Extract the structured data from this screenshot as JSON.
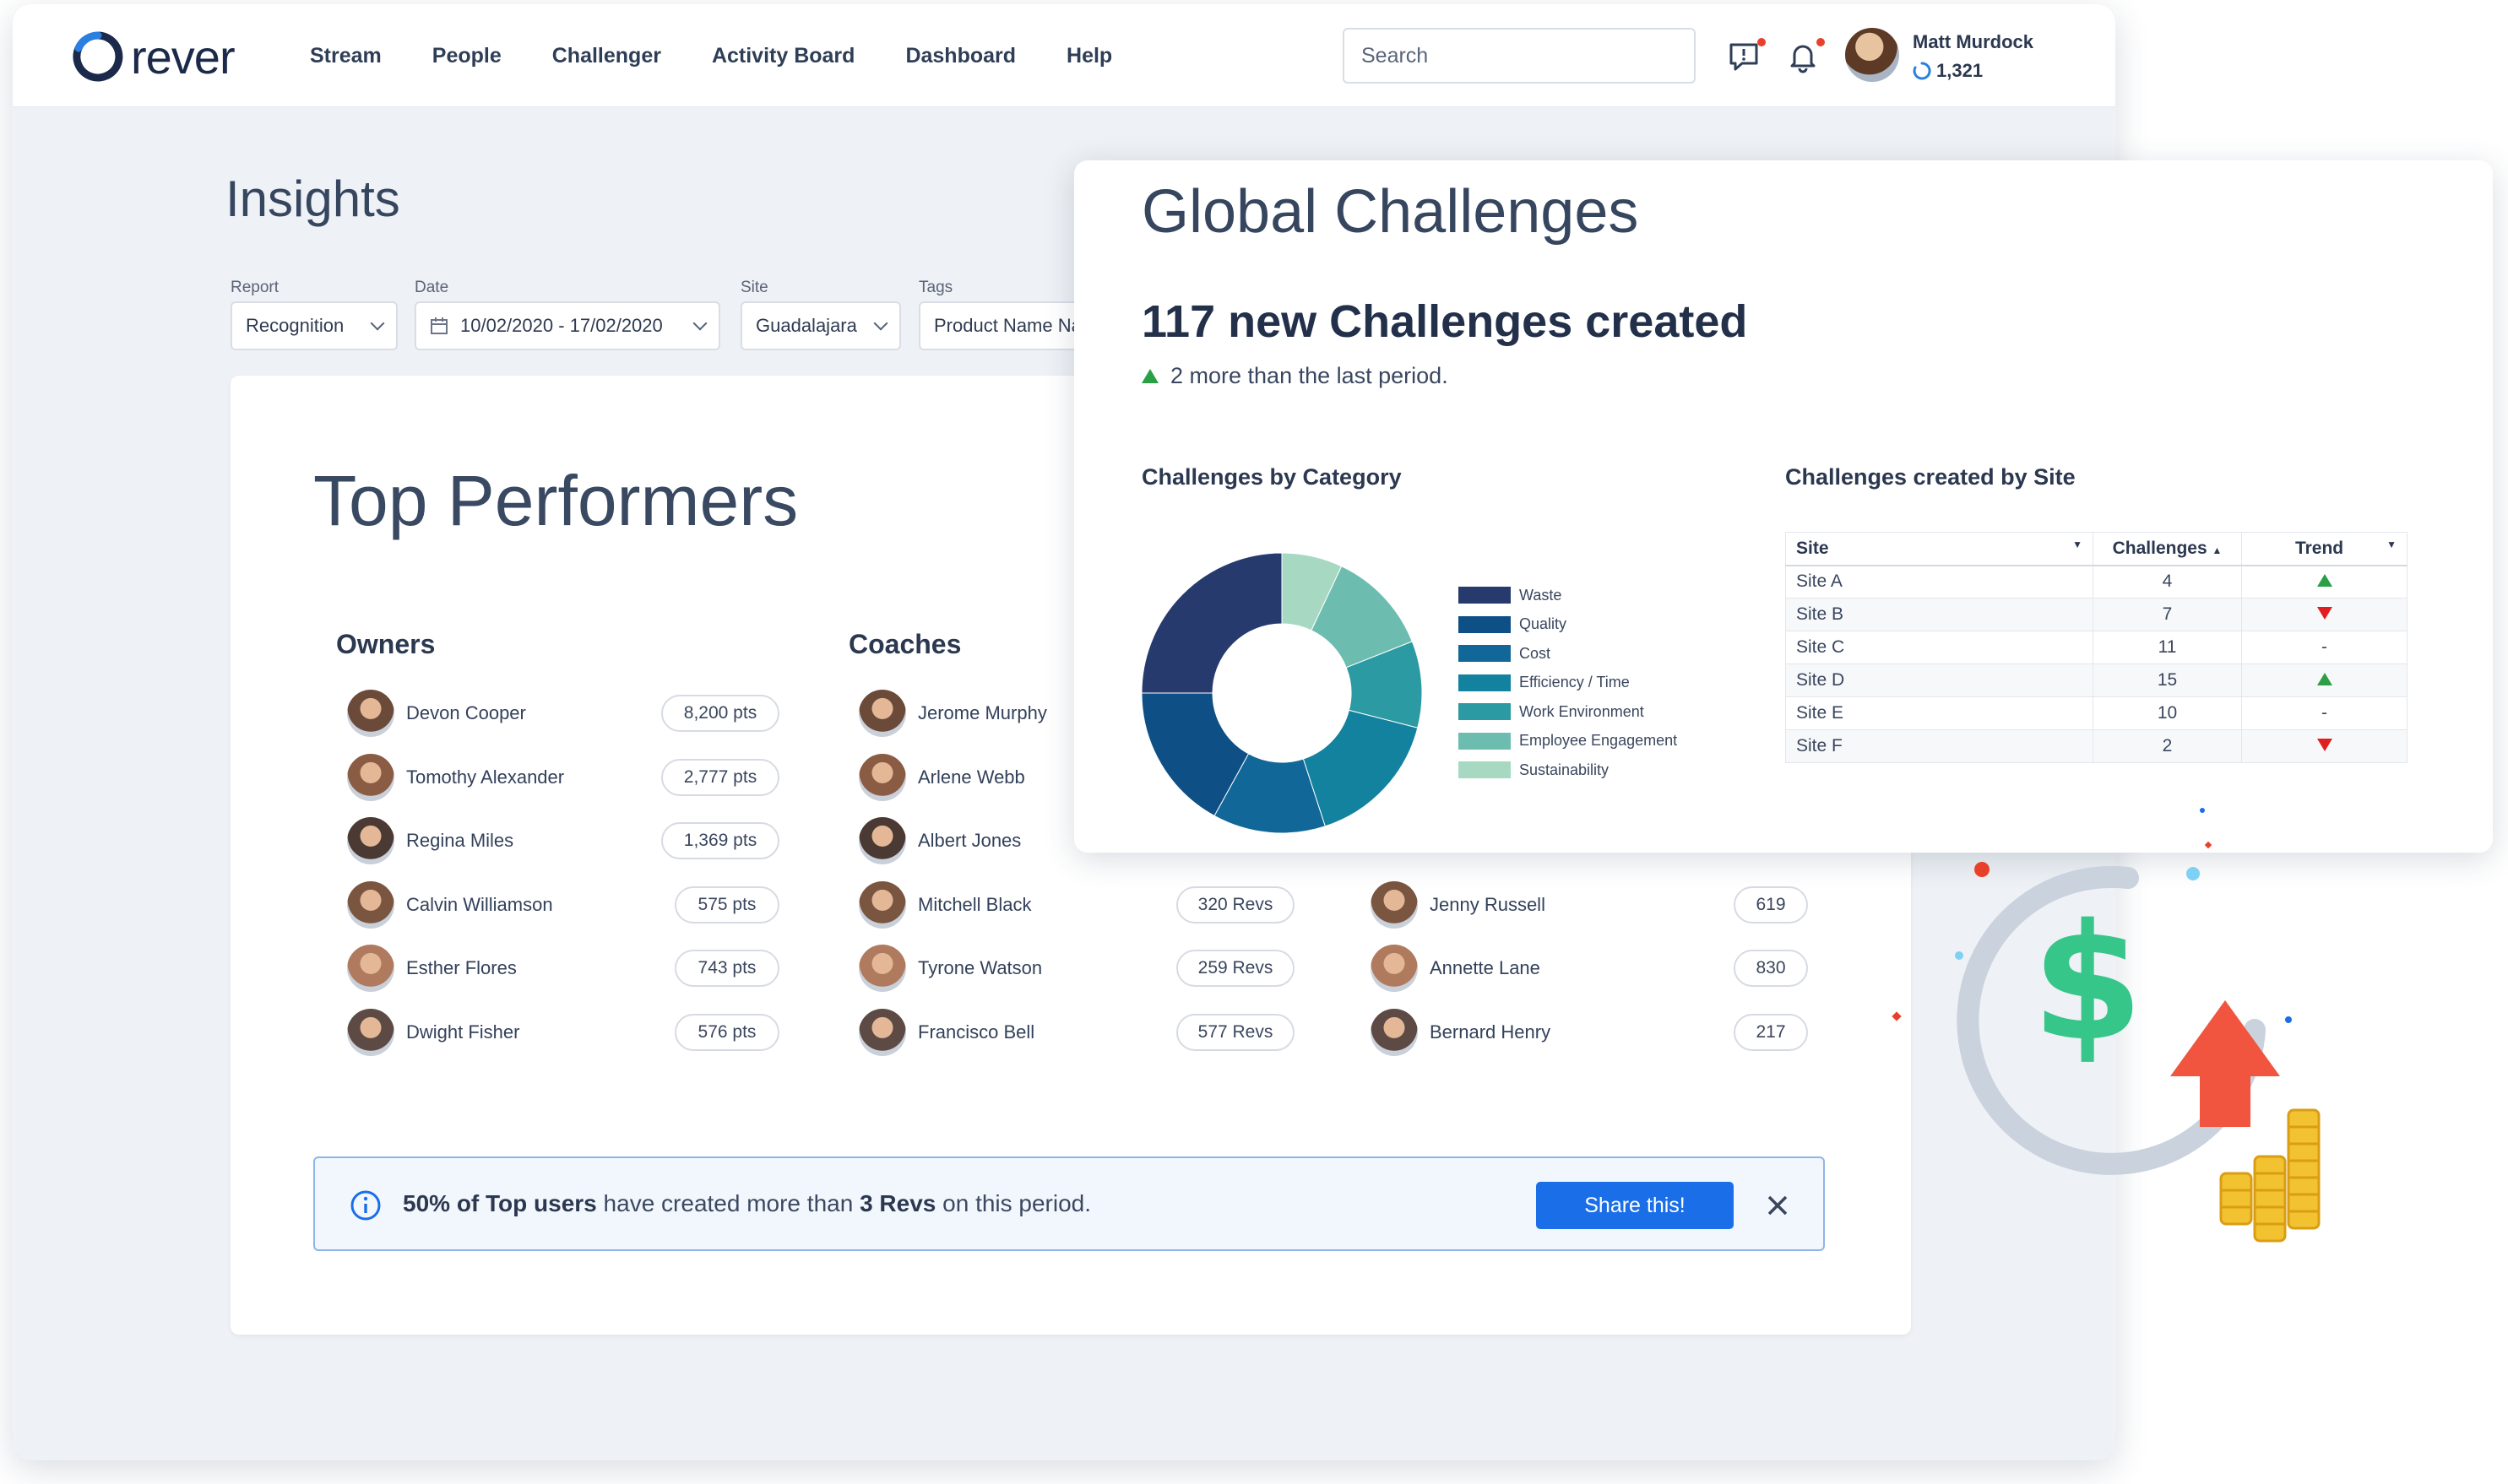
{
  "app": {
    "logo_text": "rever",
    "nav": [
      "Stream",
      "People",
      "Challenger",
      "Activity Board",
      "Dashboard",
      "Help"
    ],
    "search_placeholder": "Search",
    "user": {
      "name": "Matt Murdock",
      "points": "1,321"
    }
  },
  "insights": {
    "title": "Insights",
    "filters": [
      {
        "label": "Report",
        "value": "Recognition"
      },
      {
        "label": "Date",
        "value": "10/02/2020 - 17/02/2020"
      },
      {
        "label": "Site",
        "value": "Guadalajara"
      },
      {
        "label": "Tags",
        "value": "Product Name Na"
      }
    ]
  },
  "top_performers": {
    "title": "Top Performers",
    "owners": {
      "heading": "Owners",
      "rows": [
        {
          "name": "Devon Cooper",
          "value": "8,200 pts"
        },
        {
          "name": "Tomothy Alexander",
          "value": "2,777 pts"
        },
        {
          "name": "Regina Miles",
          "value": "1,369 pts"
        },
        {
          "name": "Calvin Williamson",
          "value": "575 pts"
        },
        {
          "name": "Esther Flores",
          "value": "743 pts"
        },
        {
          "name": "Dwight Fisher",
          "value": "576 pts"
        }
      ]
    },
    "coaches": {
      "heading": "Coaches",
      "rows": [
        {
          "name": "Jerome Murphy",
          "value": ""
        },
        {
          "name": "Arlene Webb",
          "value": ""
        },
        {
          "name": "Albert Jones",
          "value": ""
        },
        {
          "name": "Mitchell Black",
          "value": "320 Revs"
        },
        {
          "name": "Tyrone Watson",
          "value": "259 Revs"
        },
        {
          "name": "Francisco Bell",
          "value": "577 Revs"
        }
      ]
    },
    "third": {
      "rows": [
        {
          "name": "Jenny Russell",
          "value": "619"
        },
        {
          "name": "Annette Lane",
          "value": "830"
        },
        {
          "name": "Bernard Henry",
          "value": "217"
        }
      ]
    },
    "banner": {
      "strong1": "50% of Top users",
      "text1": " have created more than ",
      "strong2": "3 Revs",
      "text2": " on this period.",
      "button": "Share this!"
    }
  },
  "global_challenges": {
    "title": "Global Challenges",
    "headline": "117 new Challenges created",
    "delta": "2 more than the last period.",
    "category_title": "Challenges by Category",
    "site_title": "Challenges created by Site",
    "table": {
      "columns": [
        "Site",
        "Challenges",
        "Trend"
      ],
      "rows": [
        {
          "site": "Site A",
          "challenges": "4",
          "trend": "up"
        },
        {
          "site": "Site B",
          "challenges": "7",
          "trend": "down"
        },
        {
          "site": "Site C",
          "challenges": "11",
          "trend": "-"
        },
        {
          "site": "Site D",
          "challenges": "15",
          "trend": "up"
        },
        {
          "site": "Site E",
          "challenges": "10",
          "trend": "-"
        },
        {
          "site": "Site F",
          "challenges": "2",
          "trend": "down"
        }
      ]
    }
  },
  "chart_data": {
    "type": "pie",
    "categories": [
      "Waste",
      "Quality",
      "Cost",
      "Efficiency / Time",
      "Work Environment",
      "Employee Engagement",
      "Sustainability"
    ],
    "values": [
      25,
      17,
      13,
      16,
      10,
      12,
      7
    ],
    "colors": [
      "#263a6e",
      "#0e4f86",
      "#116898",
      "#13829f",
      "#2c9aa3",
      "#6cbdb0",
      "#a7d9c2"
    ],
    "title": "Challenges by Category"
  }
}
